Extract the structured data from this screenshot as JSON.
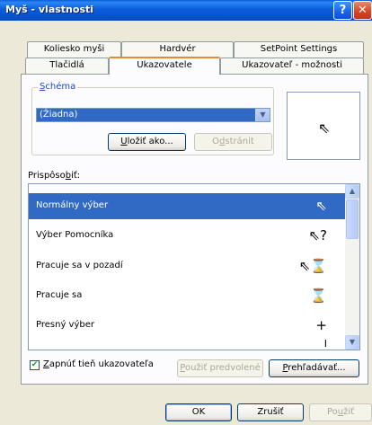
{
  "window": {
    "title": "Myš - vlastnosti",
    "help_button": "?",
    "close_button": "✕"
  },
  "tabs": {
    "back_row": [
      "Koliesko myši",
      "Hardvér",
      "SetPoint Settings"
    ],
    "front_row": [
      "Tlačidlá",
      "Ukazovatele",
      "Ukazovateľ - možnosti"
    ],
    "active": "Ukazovatele"
  },
  "schema": {
    "legend_underlined": "S",
    "legend_rest": "chéma",
    "selected_value": "(Žiadna)",
    "save_as_underlined": "U",
    "save_as_rest": "ložiť ako...",
    "delete_pre": "O",
    "delete_underlined": "d",
    "delete_rest": "stránit"
  },
  "customize": {
    "label_pre": "Prispôso",
    "label_underlined": "b",
    "label_rest": "iť:",
    "items": [
      {
        "label": "Normálny výber",
        "icon": "arrow-cursor-icon",
        "glyph": "⇖",
        "selected": true
      },
      {
        "label": "Výber Pomocníka",
        "icon": "help-cursor-icon",
        "glyph": "⇖?",
        "selected": false
      },
      {
        "label": "Pracuje sa v pozadí",
        "icon": "working-background-cursor-icon",
        "glyph": "⇖⌛",
        "selected": false
      },
      {
        "label": "Pracuje sa",
        "icon": "hourglass-cursor-icon",
        "glyph": "⌛",
        "selected": false
      },
      {
        "label": "Presný výber",
        "icon": "crosshair-cursor-icon",
        "glyph": "+",
        "selected": false
      },
      {
        "label": "",
        "icon": "text-cursor-icon",
        "glyph": "I",
        "selected": false
      }
    ]
  },
  "shadow": {
    "checked": true,
    "label_underlined": "Z",
    "label_rest": "apnúť tieň ukazovateľa"
  },
  "buttons": {
    "use_default_underlined": "P",
    "use_default_rest": "oužiť predvolené",
    "browse_underlined": "P",
    "browse_rest": "rehľadávať...",
    "ok": "OK",
    "cancel": "Zrušiť",
    "apply_pre": "Po",
    "apply_underlined": "u",
    "apply_rest": "žiť"
  }
}
